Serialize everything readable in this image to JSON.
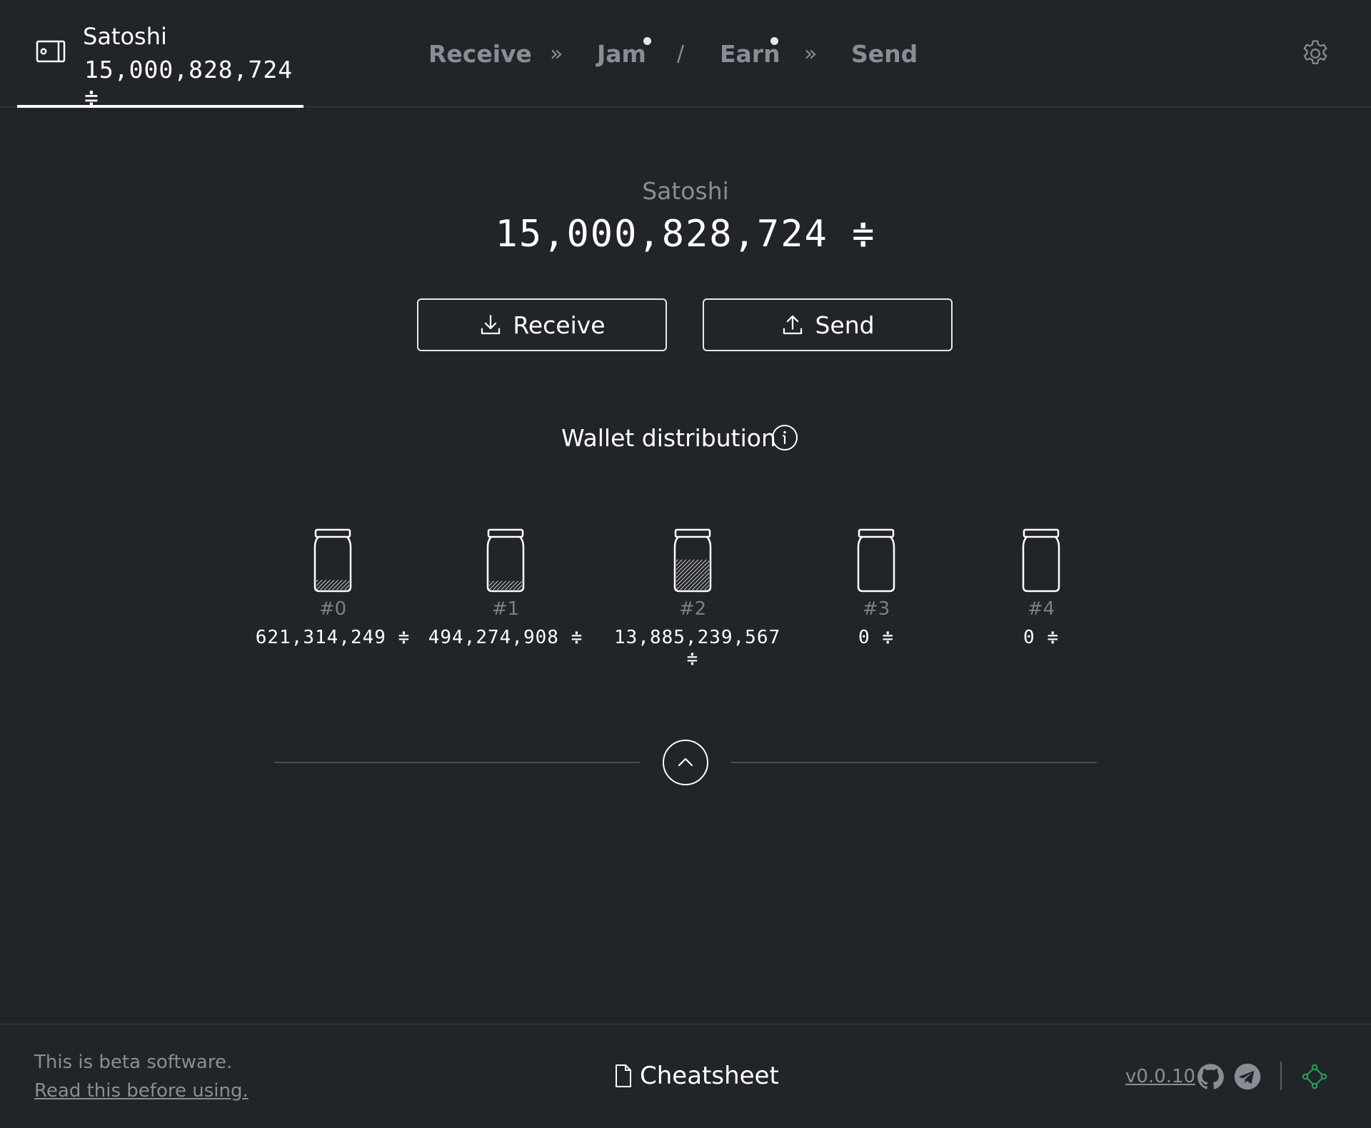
{
  "header": {
    "wallet_name": "Satoshi",
    "wallet_balance": "15,000,828,724 ≑",
    "nav": {
      "receive": "Receive",
      "sep1": "»",
      "jam": "Jam",
      "sep2": "/",
      "earn": "Earn",
      "sep3": "»",
      "send": "Send"
    }
  },
  "main": {
    "wallet_name": "Satoshi",
    "balance": "15,000,828,724 ≑",
    "receive_label": "Receive",
    "send_label": "Send",
    "distribution_title": "Wallet distribution",
    "jars": [
      {
        "label": "#0",
        "value": "621,314,249 ≑",
        "fill": 0.2
      },
      {
        "label": "#1",
        "value": "494,274,908 ≑",
        "fill": 0.18
      },
      {
        "label": "#2",
        "value": "13,885,239,567 ≑",
        "fill": 0.62
      },
      {
        "label": "#3",
        "value": "0 ≑",
        "fill": 0
      },
      {
        "label": "#4",
        "value": "0 ≑",
        "fill": 0
      }
    ]
  },
  "footer": {
    "beta_text": "This is beta software.",
    "beta_link": "Read this before using.",
    "cheatsheet": "Cheatsheet",
    "version": "v0.0.10"
  },
  "colors": {
    "background": "#212429",
    "text": "#ffffff",
    "muted": "#8a8e94",
    "connection_ok": "#22a55b"
  },
  "icons": [
    "wallet-icon",
    "settings-gear-icon",
    "download-icon",
    "upload-icon",
    "info-icon",
    "jar-icon",
    "chevron-up-icon",
    "document-icon",
    "github-icon",
    "telegram-icon",
    "network-status-icon"
  ]
}
